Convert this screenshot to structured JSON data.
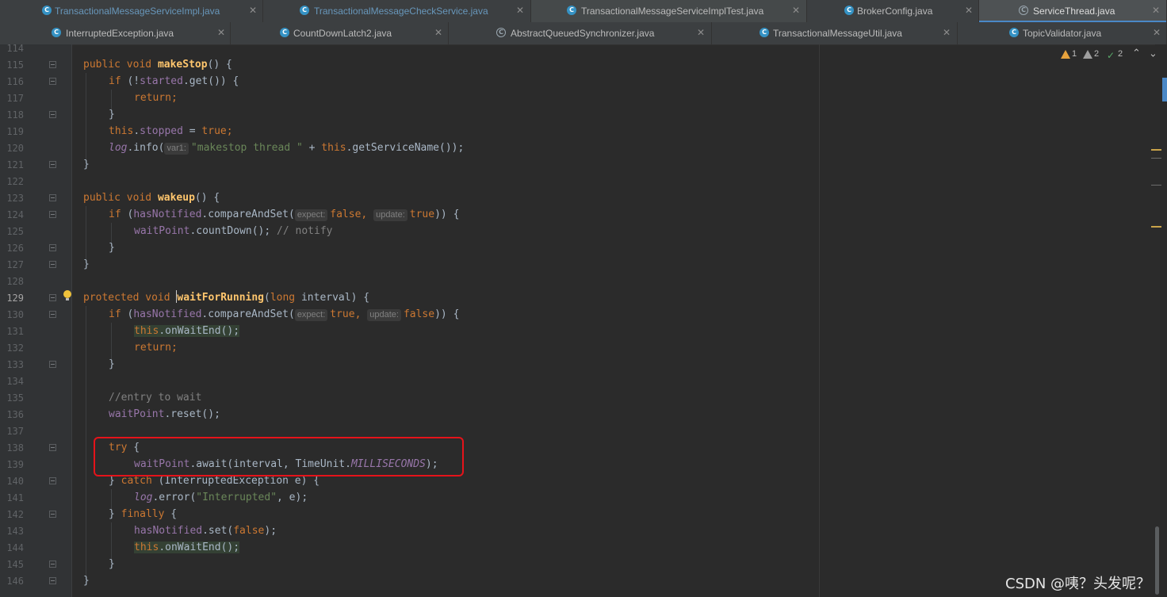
{
  "tabs_row1": [
    {
      "label": "TransactionalMessageServiceImpl.java",
      "icon": "class-icon"
    },
    {
      "label": "TransactionalMessageCheckService.java",
      "icon": "class-icon"
    },
    {
      "label": "TransactionalMessageServiceImplTest.java",
      "icon": "test-class-icon"
    },
    {
      "label": "BrokerConfig.java",
      "icon": "class-icon"
    },
    {
      "label": "ServiceThread.java",
      "icon": "abstract-class-icon",
      "active": true
    }
  ],
  "tabs_row2": [
    {
      "label": "InterruptedException.java",
      "icon": "locked-class-icon"
    },
    {
      "label": "CountDownLatch2.java",
      "icon": "class-icon"
    },
    {
      "label": "AbstractQueuedSynchronizer.java",
      "icon": "abstract-class-icon"
    },
    {
      "label": "TransactionalMessageUtil.java",
      "icon": "class-icon"
    },
    {
      "label": "TopicValidator.java",
      "icon": "class-icon"
    }
  ],
  "inspections": {
    "warnings": "1",
    "weak_warnings": "2",
    "typos": "2"
  },
  "line_numbers": [
    "114",
    "115",
    "116",
    "117",
    "118",
    "119",
    "120",
    "121",
    "122",
    "123",
    "124",
    "125",
    "126",
    "127",
    "128",
    "129",
    "130",
    "131",
    "132",
    "133",
    "134",
    "135",
    "136",
    "137",
    "138",
    "139",
    "140",
    "141",
    "142",
    "143",
    "144",
    "145",
    "146"
  ],
  "current_line": "129",
  "code": {
    "l115": {
      "kw1": "public",
      "kw2": "void",
      "fn": "makeStop",
      "rest": "() {"
    },
    "l116": {
      "kw": "if",
      "p1": " (!",
      "fld": "started",
      "p2": ".get()) {"
    },
    "l117": {
      "kw": "return",
      "p": ";"
    },
    "l118": {
      "p": "}"
    },
    "l119": {
      "kw": "this",
      "p1": ".",
      "fld": "stopped",
      "p2": " = ",
      "kw2": "true",
      "p3": ";"
    },
    "l120": {
      "fld": "log",
      "p1": ".info(",
      "hint": "var1:",
      "str": "\"makestop thread \"",
      "p2": " + ",
      "kw": "this",
      "p3": ".getServiceName());"
    },
    "l121": {
      "p": "}"
    },
    "l123": {
      "kw1": "public",
      "kw2": "void",
      "fn": "wakeup",
      "rest": "() {"
    },
    "l124": {
      "kw": "if",
      "p1": " (",
      "fld": "hasNotified",
      "p2": ".compareAndSet(",
      "hint1": "expect:",
      "v1": "false",
      "p3": ", ",
      "hint2": "update:",
      "v2": "true",
      "p4": ")) {"
    },
    "l125": {
      "fld": "waitPoint",
      "p1": ".countDown();",
      "cmt": " // notify"
    },
    "l126": {
      "p": "}"
    },
    "l127": {
      "p": "}"
    },
    "l129": {
      "kw1": "protected",
      "kw2": "void",
      "fn": "waitForRunning",
      "p1": "(",
      "kw3": "long",
      "p2": " interval) {"
    },
    "l130": {
      "kw": "if",
      "p1": " (",
      "fld": "hasNotified",
      "p2": ".compareAndSet(",
      "hint1": "expect:",
      "v1": "true",
      "p3": ", ",
      "hint2": "update:",
      "v2": "false",
      "p4": ")) {"
    },
    "l131": {
      "kw": "this",
      "p": ".onWaitEnd();"
    },
    "l132": {
      "kw": "return",
      "p": ";"
    },
    "l133": {
      "p": "}"
    },
    "l135": {
      "cmt": "//entry to wait"
    },
    "l136": {
      "fld": "waitPoint",
      "p": ".reset();"
    },
    "l138": {
      "kw": "try",
      "p": " {"
    },
    "l139": {
      "fld": "waitPoint",
      "p1": ".await(interval, TimeUnit.",
      "stat": "MILLISECONDS",
      "p2": ");"
    },
    "l140": {
      "p1": "} ",
      "kw": "catch",
      "p2": " (InterruptedException e) {"
    },
    "l141": {
      "fld": "log",
      "p1": ".error(",
      "str": "\"Interrupted\"",
      "p2": ", e);"
    },
    "l142": {
      "p1": "} ",
      "kw": "finally",
      "p2": " {"
    },
    "l143": {
      "fld": "hasNotified",
      "p1": ".set(",
      "kw": "false",
      "p2": ");"
    },
    "l144": {
      "kw": "this",
      "p": ".onWaitEnd();"
    },
    "l145": {
      "p": "}"
    },
    "l146": {
      "p": "}"
    }
  },
  "watermark": "CSDN @咦？头发呢？",
  "colors": {
    "keyword": "#cc7832",
    "method": "#ffc66d",
    "field": "#9876aa",
    "string": "#6a8759",
    "comment": "#808080",
    "highlight_box": "#e5131a"
  }
}
